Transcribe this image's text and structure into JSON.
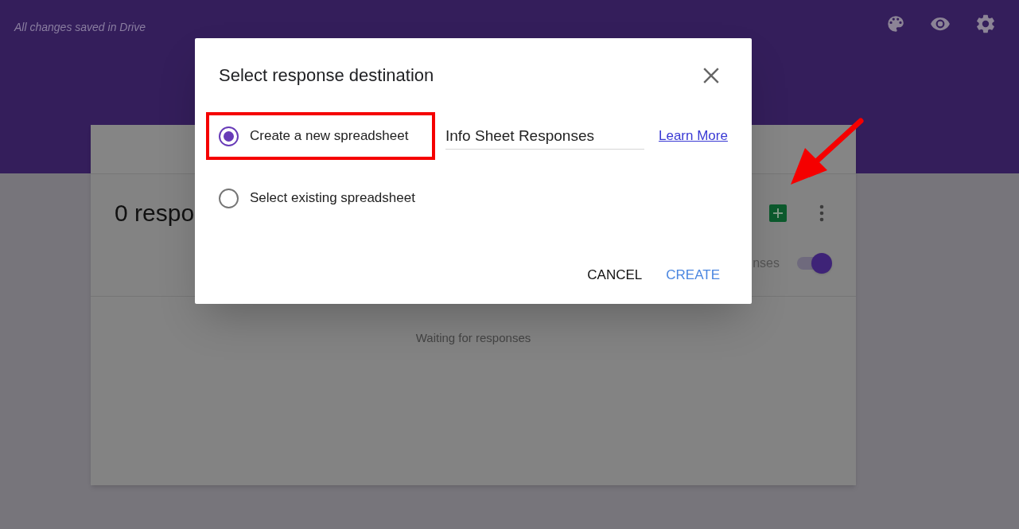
{
  "header": {
    "status": "All changes saved in Drive"
  },
  "responses_card": {
    "title": "0 respo",
    "toggle_label": "nses",
    "accepting": true,
    "empty_message": "Waiting for responses"
  },
  "dialog": {
    "title": "Select response destination",
    "spreadsheet_name": "Info Sheet Responses",
    "link": "Learn More",
    "options": [
      {
        "label": "Create a new spreadsheet",
        "selected": true,
        "highlighted": true
      },
      {
        "label": "Select existing spreadsheet",
        "selected": false,
        "highlighted": false
      }
    ],
    "buttons": [
      {
        "label": "CANCEL",
        "kind": "plain"
      },
      {
        "label": "CREATE",
        "kind": "primary"
      }
    ]
  }
}
